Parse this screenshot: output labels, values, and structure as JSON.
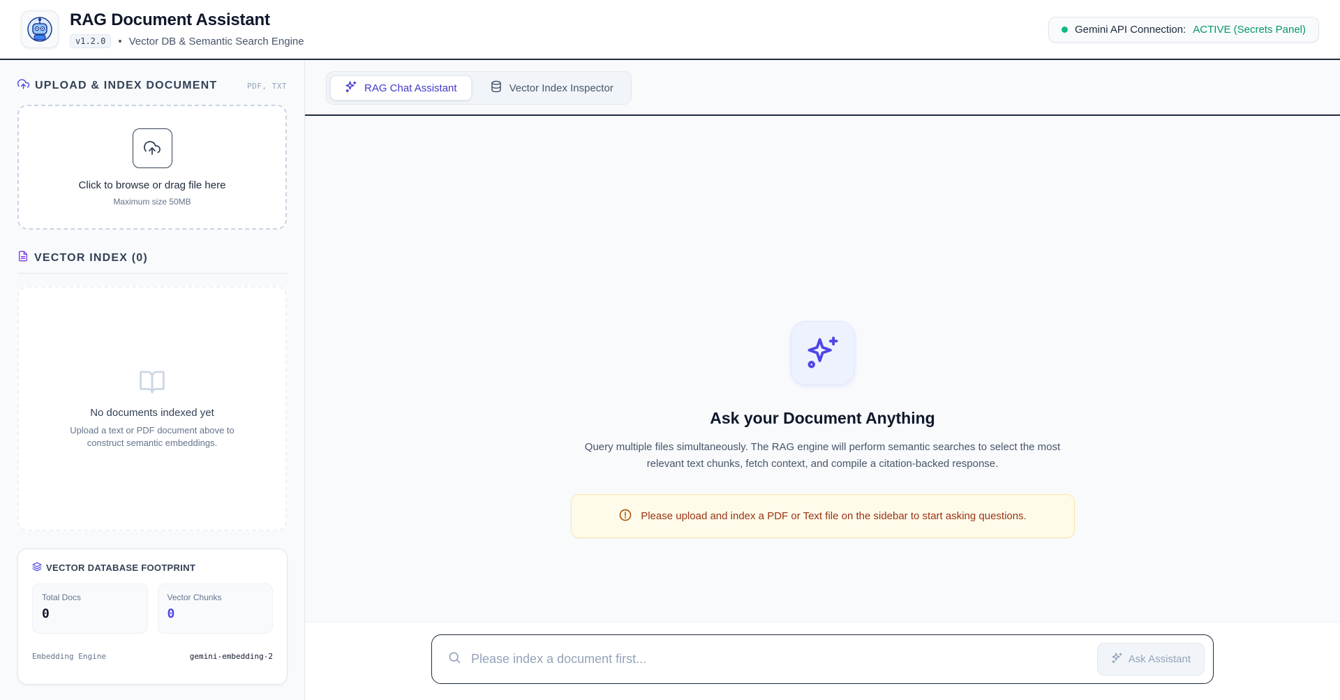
{
  "header": {
    "title": "RAG Document Assistant",
    "version": "v1.2.0",
    "separator": "•",
    "subtitle": "Vector DB & Semantic Search Engine",
    "status_label": "Gemini API Connection:",
    "status_value": "ACTIVE (Secrets Panel)"
  },
  "sidebar": {
    "upload": {
      "title": "UPLOAD & INDEX DOCUMENT",
      "formats": "PDF, TXT",
      "drop_text": "Click to browse or drag file here",
      "drop_subtext": "Maximum size 50MB"
    },
    "vector_index": {
      "title": "VECTOR INDEX (0)",
      "empty_title": "No documents indexed yet",
      "empty_subtitle": "Upload a text or PDF document above to construct semantic embeddings."
    },
    "footprint": {
      "title": "VECTOR DATABASE FOOTPRINT",
      "total_docs_label": "Total Docs",
      "total_docs_value": "0",
      "chunks_label": "Vector Chunks",
      "chunks_value": "0",
      "engine_label": "Embedding Engine",
      "engine_value": "gemini-embedding-2"
    }
  },
  "tabs": [
    {
      "label": "RAG Chat Assistant",
      "icon": "sparkles-icon",
      "active": true
    },
    {
      "label": "Vector Index Inspector",
      "icon": "database-icon",
      "active": false
    }
  ],
  "hero": {
    "title": "Ask your Document Anything",
    "subtitle": "Query multiple files simultaneously. The RAG engine will perform semantic searches to select the most relevant text chunks, fetch context, and compile a citation-backed response.",
    "warning": "Please upload and index a PDF or Text file on the sidebar to start asking questions."
  },
  "query": {
    "placeholder": "Please index a document first...",
    "value": "",
    "button_label": "Ask Assistant"
  },
  "colors": {
    "accent": "#4f46e5",
    "status_green": "#10b981",
    "warning_bg": "#fefbea",
    "warning_text": "#9a3412"
  }
}
